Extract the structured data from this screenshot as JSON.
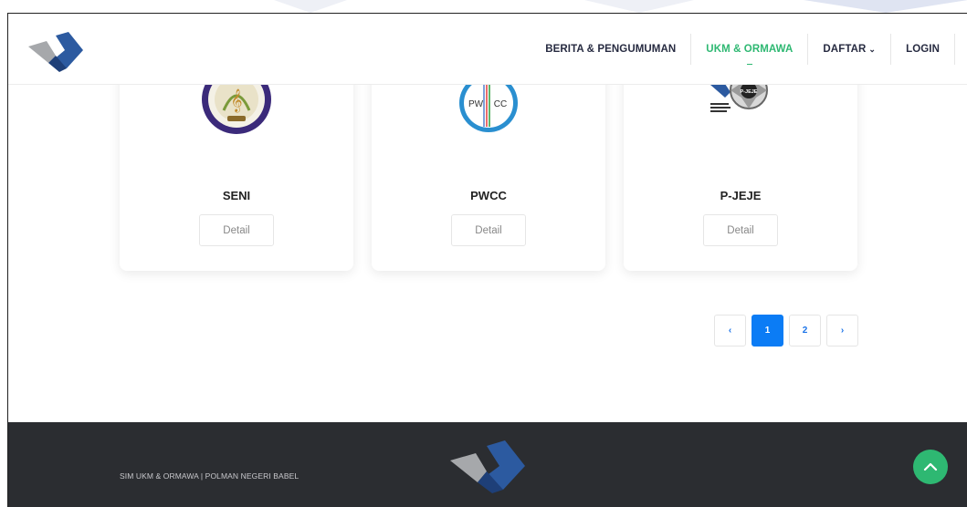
{
  "nav": {
    "items": [
      {
        "label": "BERITA & PENGUMUMAN",
        "active": false
      },
      {
        "label": "UKM & ORMAWA",
        "active": true
      },
      {
        "label": "DAFTAR",
        "active": false,
        "dropdown": true
      },
      {
        "label": "LOGIN",
        "active": false
      }
    ]
  },
  "cards": [
    {
      "title": "SENI",
      "button": "Detail",
      "logo_icon": "seni-emblem-icon"
    },
    {
      "title": "PWCC",
      "button": "Detail",
      "logo_icon": "pwcc-emblem-icon",
      "logo_text_left": "PW",
      "logo_text_right": "CC"
    },
    {
      "title": "P-JEJE",
      "button": "Detail",
      "logo_icon": "pjeje-emblem-icon",
      "logo_text": "P-JEJE"
    }
  ],
  "pagination": {
    "prev": "‹",
    "pages": [
      "1",
      "2"
    ],
    "current": "1",
    "next": "›"
  },
  "footer": {
    "text": "SIM UKM & ORMAWA | POLMAN NEGERI BABEL"
  },
  "colors": {
    "accent": "#2eb872",
    "primary": "#0b7cf5",
    "footer_bg": "#2b2d31",
    "logo_blue": "#2c5aa0",
    "logo_gray": "#a6a8ab"
  }
}
